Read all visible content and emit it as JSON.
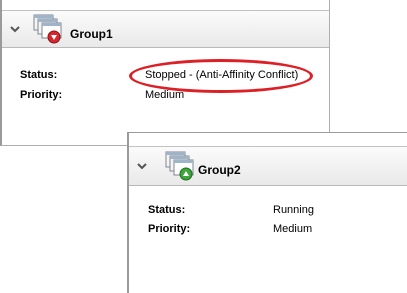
{
  "group1": {
    "title": "Group1",
    "status_label": "Status:",
    "status_value": "Stopped - (Anti-Affinity Conflict)",
    "priority_label": "Priority:",
    "priority_value": "Medium",
    "icon": "group-stopped-icon",
    "status_badge_color": "#d7262e",
    "highlight_color": "#dd1f26"
  },
  "group2": {
    "title": "Group2",
    "status_label": "Status:",
    "status_value": "Running",
    "priority_label": "Priority:",
    "priority_value": "Medium",
    "icon": "group-running-icon",
    "status_badge_color": "#3ea63a"
  }
}
